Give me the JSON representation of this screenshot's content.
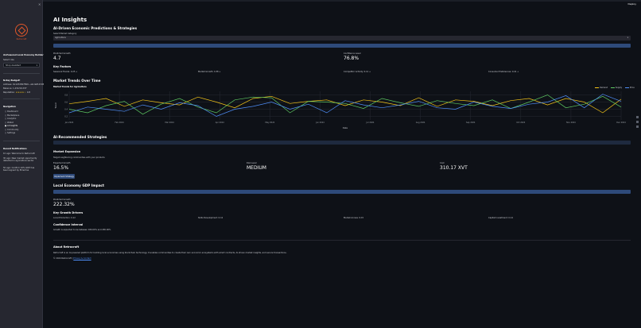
{
  "toolbar": {
    "deploy_label": "Deploy"
  },
  "sidebar": {
    "collapse_icon": "chevron-left-icon",
    "logo_text": "Retrocraft",
    "title": "AI-Powered Local Economy Builder",
    "select_label": "Select role",
    "select_value": "Shop Assistant",
    "wallet_heading": "N-Day Budget!",
    "address": "Address: 0x1234567890...abcdef12345",
    "balance": "Balance: 1,234.56 XVT",
    "reputation_label": "Reputation:",
    "reputation_stars": "★★★★☆",
    "reputation_value": "4.8",
    "nav_heading": "Navigation",
    "nav_items": [
      "Dashboard",
      "Marketplace",
      "Analytics",
      "Wallet",
      "AI Insights",
      "Community",
      "Settings"
    ],
    "notif_heading": "Recent Notifications",
    "notifications": [
      "1h ago: Welcome to Retrocraft",
      "3h ago: New market opportunity detected in agriculture sector",
      "5h ago: Confirm 10% GDP has been signed by Emerline"
    ]
  },
  "main": {
    "title": "AI Insights",
    "predictions_heading": "AI-Driven Economic Predictions & Strategies",
    "sector_label": "Select Market Category",
    "sector_value": "Agriculture",
    "predicted_growth_label": "Predicted Growth",
    "predicted_growth_value": "4.7",
    "confidence_label": "Confidence Level",
    "confidence_value": "76.8%",
    "key_factors_heading": "Key Factors",
    "key_factors": [
      "Seasonal Trends: 0.25 +",
      "Market Growth: 0.38 +",
      "Competitor Activity: 0.12 +",
      "Consumer Preferences: 0.41 +"
    ],
    "trends_heading": "Market Trends Over Time",
    "strategies_heading": "AI-Recommended Strategies",
    "strategy": {
      "name": "Market Expansion",
      "description": "Target neighboring communities with your products",
      "growth_label": "Expected Growth",
      "growth_value": "16.5%",
      "risk_label": "Risk Level",
      "risk_value": "MEDIUM",
      "cost_label": "Cost",
      "cost_value": "310.17 XVT",
      "button_label": "Implement Strategy"
    },
    "gdp_heading": "Local Economy GDP Impact",
    "gdp_label": "Predicted Growth",
    "gdp_value": "222.32%",
    "drivers_heading": "Key Growth Drivers",
    "drivers": [
      "Local Production: 0.12",
      "Skills Development: 0.12",
      "Market Access: 0.15",
      "Capital Investment: 0.14"
    ],
    "ci_heading": "Confidence Interval",
    "ci_text": "Growth is expected to be between 180.00% and 265.00%",
    "about_heading": "About Retrocraft",
    "about_text": "Retrocraft is an AI-powered platform for building local economies using blockchain technology. It enables communities to create their own economic ecosystems with smart contracts, AI-driven market insights, and secure transactions.",
    "copyright_prefix": "© 2024 Retrocraft |",
    "copyright_link": "Privacy & Contact"
  },
  "chart_data": {
    "type": "line",
    "title": "Market Trends for Agriculture",
    "xlabel": "Date",
    "ylabel": "Trend",
    "x": [
      "Jan 1",
      "Jan 8",
      "Jan 15",
      "Jan 22",
      "Jan 29",
      "Feb 5",
      "Feb 12",
      "Feb 19",
      "Feb 26",
      "Mar 4",
      "Mar 11",
      "Mar 18",
      "Mar 25",
      "Apr 1",
      "Apr 8",
      "Apr 15",
      "Apr 22",
      "Apr 29",
      "May 6",
      "May 13",
      "May 20",
      "May 27",
      "Jun 3",
      "Jun 10",
      "Jun 17",
      "Jun 24",
      "Jul 1",
      "Jul 8",
      "Jul 15",
      "Jul 22",
      "Jul 29"
    ],
    "xticks": [
      "Jan 2024",
      "Feb 2024",
      "Mar 2024",
      "Apr 2024",
      "May 2024",
      "Jun 2024",
      "Jul 2024",
      "Aug 2024",
      "Sep 2024",
      "Oct 2024",
      "Nov 2024",
      "Dec 2024"
    ],
    "yticks": [
      "0.2",
      "0.4",
      "0.6",
      "0.8"
    ],
    "ylim": [
      0.1,
      0.9
    ],
    "legend_position": "top-right",
    "series": [
      {
        "name": "Demand",
        "color": "#f5c518",
        "values": [
          0.55,
          0.62,
          0.7,
          0.48,
          0.66,
          0.58,
          0.52,
          0.74,
          0.6,
          0.44,
          0.7,
          0.76,
          0.56,
          0.62,
          0.66,
          0.5,
          0.66,
          0.6,
          0.5,
          0.72,
          0.48,
          0.66,
          0.62,
          0.5,
          0.64,
          0.7,
          0.52,
          0.7,
          0.6,
          0.3,
          0.68
        ]
      },
      {
        "name": "Supply",
        "color": "#5ec962",
        "values": [
          0.4,
          0.3,
          0.5,
          0.62,
          0.26,
          0.54,
          0.7,
          0.46,
          0.3,
          0.66,
          0.74,
          0.72,
          0.3,
          0.62,
          0.6,
          0.56,
          0.42,
          0.7,
          0.58,
          0.48,
          0.64,
          0.56,
          0.5,
          0.66,
          0.42,
          0.6,
          0.8,
          0.44,
          0.54,
          0.76,
          0.46
        ]
      },
      {
        "name": "Price",
        "color": "#4f8ef7",
        "values": [
          0.3,
          0.46,
          0.4,
          0.34,
          0.52,
          0.4,
          0.58,
          0.5,
          0.2,
          0.4,
          0.48,
          0.6,
          0.4,
          0.54,
          0.3,
          0.64,
          0.52,
          0.44,
          0.52,
          0.62,
          0.44,
          0.4,
          0.6,
          0.48,
          0.42,
          0.54,
          0.6,
          0.78,
          0.44,
          0.82,
          0.62
        ]
      }
    ]
  }
}
